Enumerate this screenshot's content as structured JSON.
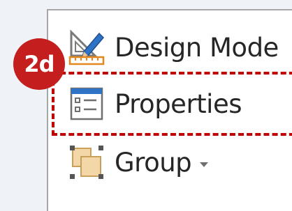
{
  "ribbon": {
    "controls": [
      {
        "label": "Design Mode",
        "icon": "design-mode-icon"
      },
      {
        "label": "Properties",
        "icon": "properties-icon"
      },
      {
        "label": "Group",
        "icon": "group-icon",
        "has_dropdown": true
      }
    ]
  },
  "annotation": {
    "step": "2d",
    "color": "#c41e1e",
    "highlight_color": "#c00000",
    "highlighted_item": "Properties"
  }
}
